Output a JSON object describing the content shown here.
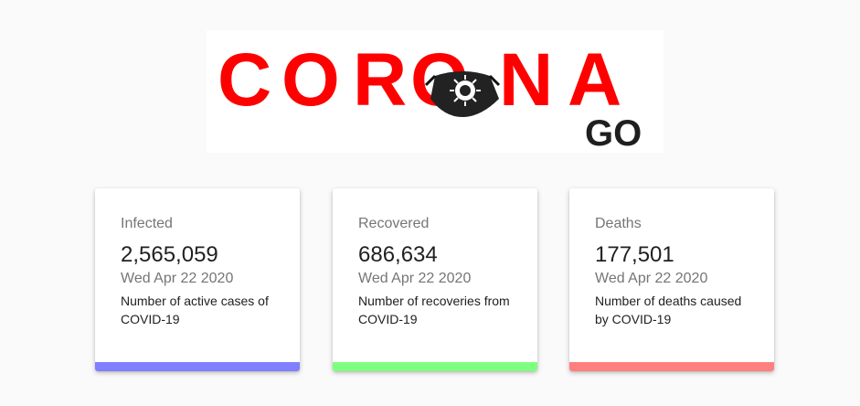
{
  "logo": {
    "word": "CORONA",
    "sub": "GO",
    "color_red": "#ff0000",
    "color_dark": "#1f1f1f"
  },
  "cards": [
    {
      "label": "Infected",
      "value": "2,565,059",
      "date": "Wed Apr 22 2020",
      "description": "Number of active cases of COVID-19",
      "accent": "#7f7fff"
    },
    {
      "label": "Recovered",
      "value": "686,634",
      "date": "Wed Apr 22 2020",
      "description": "Number of recoveries from COVID-19",
      "accent": "#7fff7f"
    },
    {
      "label": "Deaths",
      "value": "177,501",
      "date": "Wed Apr 22 2020",
      "description": "Number of deaths caused by COVID-19",
      "accent": "#ff7f7f"
    }
  ]
}
